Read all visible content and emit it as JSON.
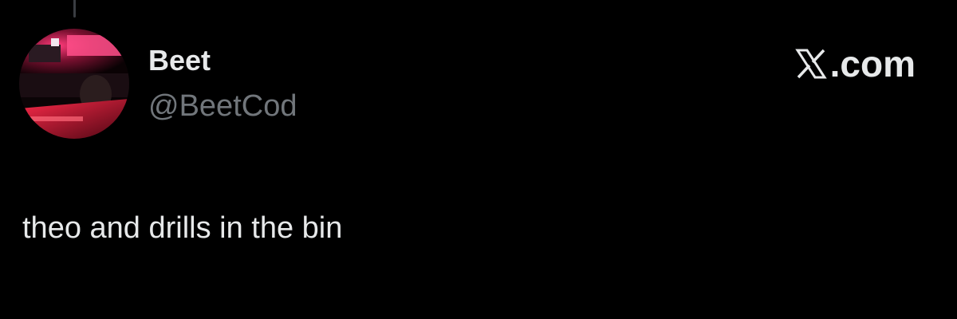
{
  "tweet": {
    "author": {
      "display_name": "Beet",
      "handle": "@BeetCod",
      "avatar_icon": "user-avatar-photo"
    },
    "text": "theo and drills in the bin",
    "source_suffix": ".com",
    "source_icon": "x-logo-icon"
  },
  "colors": {
    "background": "#000000",
    "primary_text": "#e7e9ea",
    "secondary_text": "#71767b"
  }
}
